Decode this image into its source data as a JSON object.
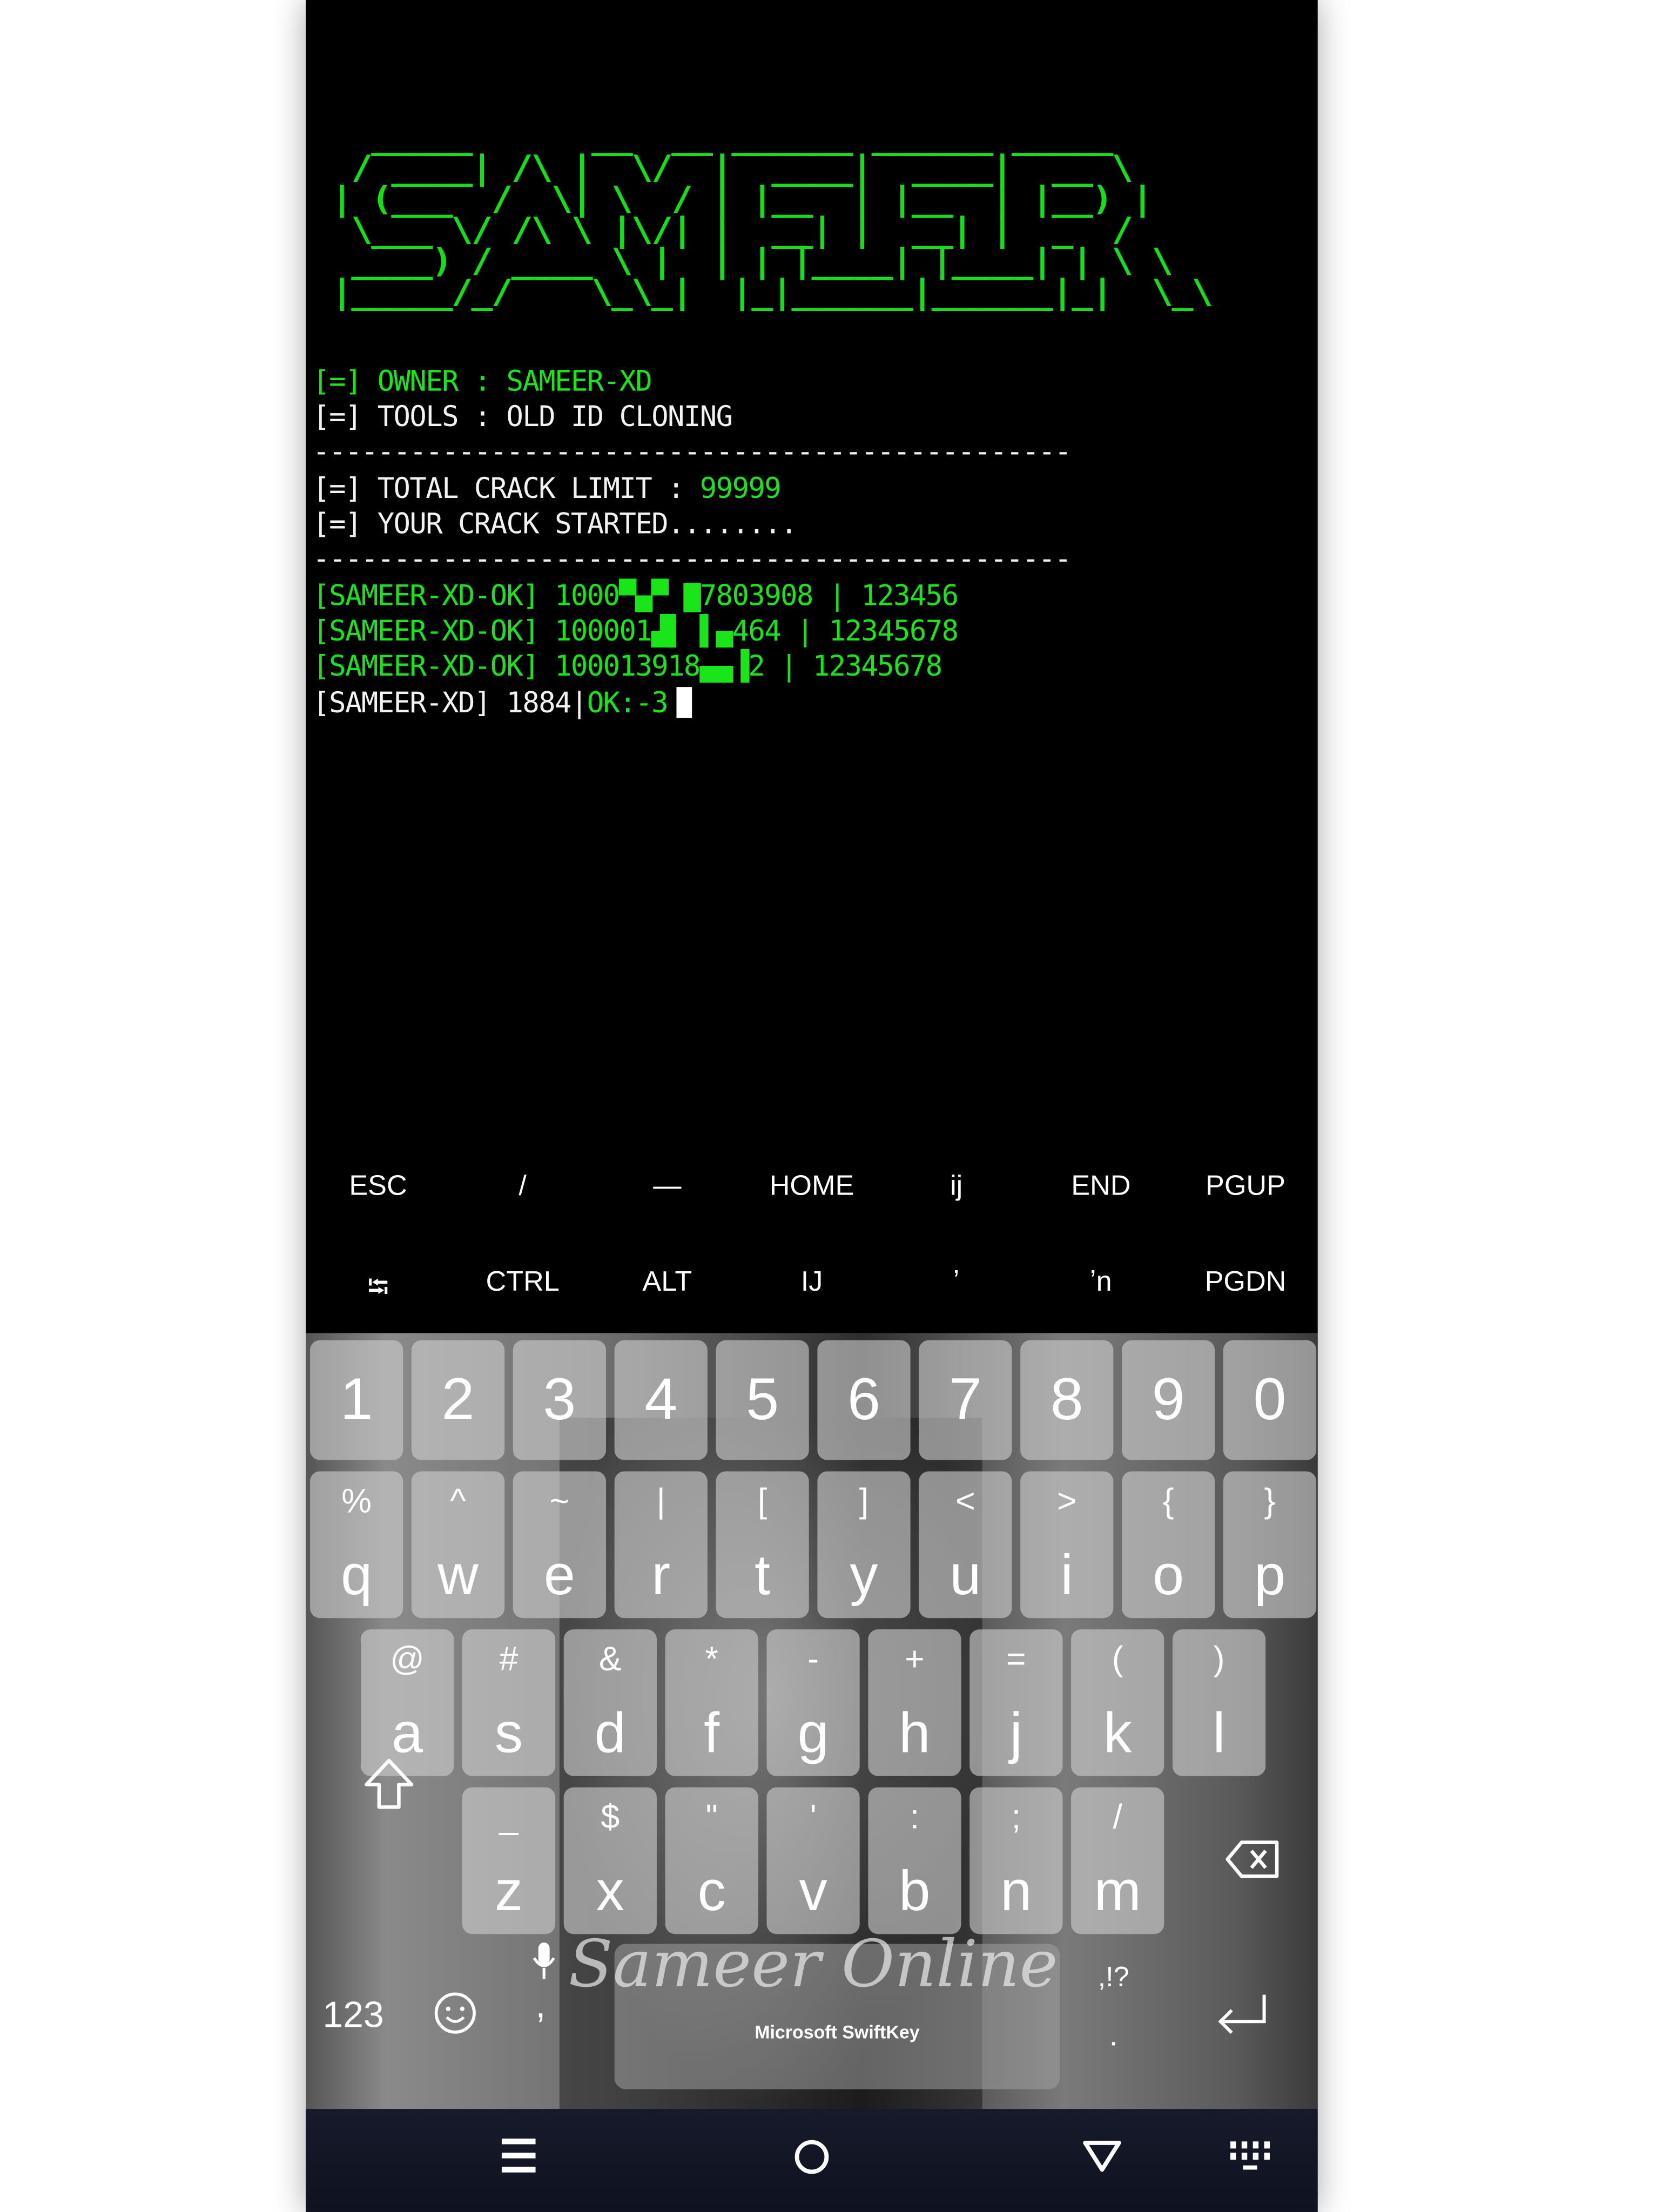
{
  "terminal": {
    "banner": [
      "  _____      __  __ ______ ______ _____  ",
      " / ____| /\\ |  \\/  |  ____|  ____|  __ \\ ",
      "| (___  /  \\| \\  / | |__  | |__  | |__) |",
      " \\___ \\/ /\\ \\ |\\/| |  __| |  __| |  _  / ",
      " ____) / ____ \\ |  | | |____| |____| | \\ \\ ",
      "|_____/_/    \\_\\_|  |_|______|______|_|  \\_\\"
    ],
    "owner_prefix": "[=]",
    "owner_label": " OWNER : SAMEER-XD",
    "tools_prefix": "[=]",
    "tools_label": " TOOLS : OLD ID CLONING",
    "divider": "-----------------------------------------------",
    "limit_prefix": "[=]",
    "limit_label": " TOTAL CRACK LIMIT : ",
    "limit_value": "99999",
    "started_prefix": "[=]",
    "started_label": " YOUR CRACK STARTED........",
    "results": [
      "[SAMEER-XD-OK] 1000▀▄▀ ▇7803908 | 123456",
      "[SAMEER-XD-OK] 100001▟▌ ▌▄464 | 12345678",
      "[SAMEER-XD-OK] 100013918▄▄▐2 | 12345678"
    ],
    "status_label": "[SAMEER-XD] 1884|",
    "status_ok": "OK:-3"
  },
  "extra_keys": {
    "row1": [
      "ESC",
      "/",
      "—",
      "HOME",
      "ij",
      "END",
      "PGUP"
    ],
    "row2": [
      "⭾",
      "CTRL",
      "ALT",
      "IJ",
      "ʼ",
      "ʼn",
      "PGDN"
    ]
  },
  "keyboard": {
    "numbers": [
      "1",
      "2",
      "3",
      "4",
      "5",
      "6",
      "7",
      "8",
      "9",
      "0"
    ],
    "row1": [
      [
        "q",
        "%"
      ],
      [
        "w",
        "^"
      ],
      [
        "e",
        "~"
      ],
      [
        "r",
        "|"
      ],
      [
        "t",
        "["
      ],
      [
        "y",
        "]"
      ],
      [
        "u",
        "<"
      ],
      [
        "i",
        ">"
      ],
      [
        "o",
        "{"
      ],
      [
        "p",
        "}"
      ]
    ],
    "row2": [
      [
        "a",
        "@"
      ],
      [
        "s",
        "#"
      ],
      [
        "d",
        "&"
      ],
      [
        "f",
        "*"
      ],
      [
        "g",
        "-"
      ],
      [
        "h",
        "+"
      ],
      [
        "j",
        "="
      ],
      [
        "k",
        "("
      ],
      [
        "l",
        ")"
      ]
    ],
    "row3": [
      [
        "z",
        "_"
      ],
      [
        "x",
        "$"
      ],
      [
        "c",
        "\""
      ],
      [
        "v",
        "'"
      ],
      [
        "b",
        ":"
      ],
      [
        "n",
        ";"
      ],
      [
        "m",
        "/"
      ]
    ],
    "numbers_toggle": "123",
    "comma": ",",
    "punct": ",!?",
    "period": ".",
    "space_label": "Microsoft SwiftKey",
    "watermark": "Sameer Online"
  },
  "colors": {
    "terminal_green": "#19e619",
    "nav_bar": "#141828"
  }
}
